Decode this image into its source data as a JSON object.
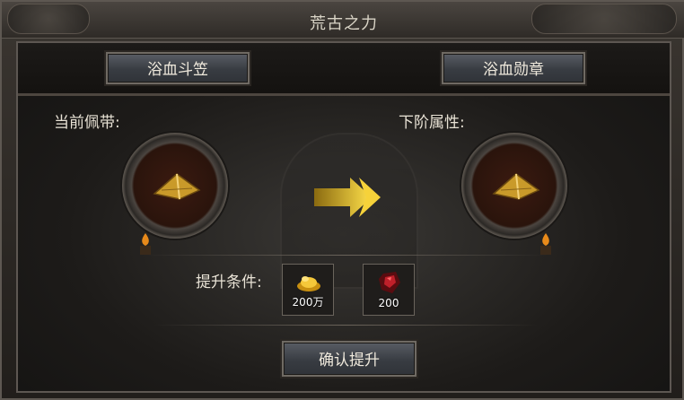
{
  "window": {
    "title": "荒古之力"
  },
  "tabs": [
    {
      "label": "浴血斗笠"
    },
    {
      "label": "浴血勋章"
    }
  ],
  "current": {
    "label": "当前佩带:",
    "item_icon": "bamboo-hat-icon"
  },
  "next": {
    "label": "下阶属性:",
    "item_icon": "bamboo-hat-icon"
  },
  "requirements": {
    "label": "提升条件:",
    "items": [
      {
        "icon": "gold-ingot-icon",
        "count": "200万"
      },
      {
        "icon": "red-gem-icon",
        "count": "200"
      }
    ]
  },
  "confirm_button": {
    "label": "确认提升"
  },
  "colors": {
    "accent_gold": "#e0b020",
    "text": "#e8e2d5"
  }
}
